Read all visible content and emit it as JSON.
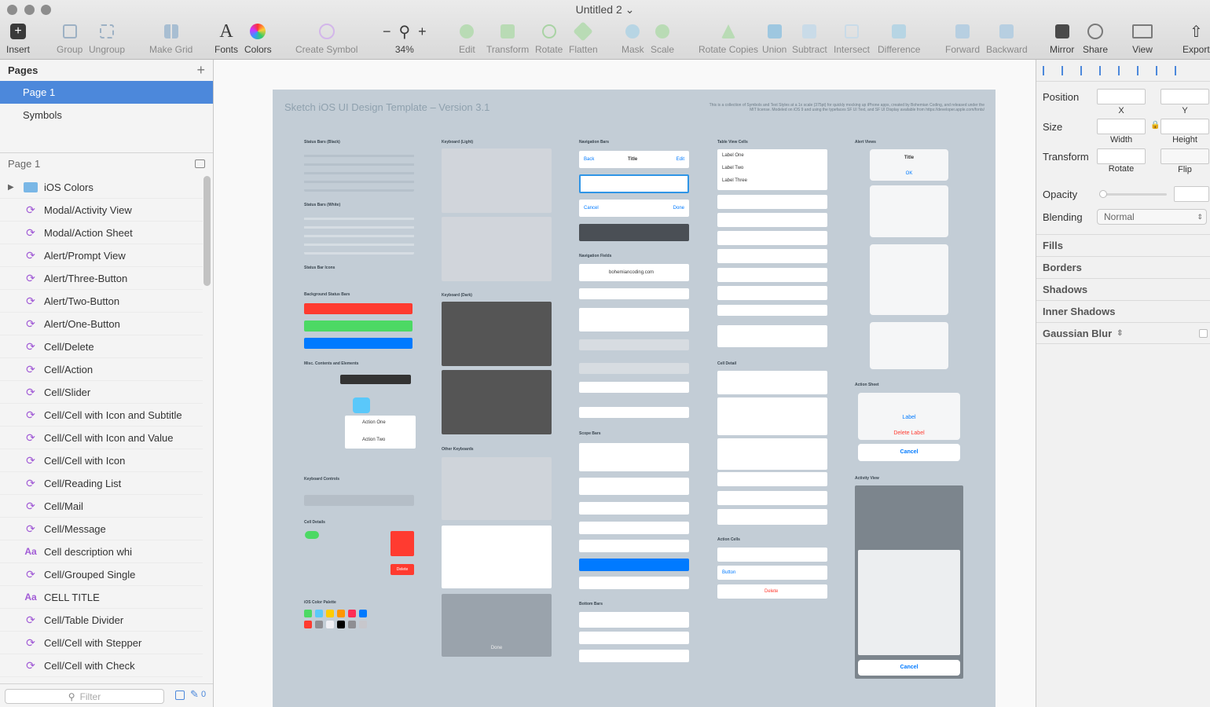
{
  "window": {
    "title": "Untitled 2 ⌄"
  },
  "toolbar": {
    "insert": "Insert",
    "group": "Group",
    "ungroup": "Ungroup",
    "make_grid": "Make Grid",
    "fonts": "Fonts",
    "colors": "Colors",
    "create_symbol": "Create Symbol",
    "zoom": "34%",
    "edit": "Edit",
    "transform": "Transform",
    "rotate": "Rotate",
    "flatten": "Flatten",
    "mask": "Mask",
    "scale": "Scale",
    "rotate_copies": "Rotate Copies",
    "union": "Union",
    "subtract": "Subtract",
    "intersect": "Intersect",
    "difference": "Difference",
    "forward": "Forward",
    "backward": "Backward",
    "mirror": "Mirror",
    "share": "Share",
    "view": "View",
    "export": "Export"
  },
  "pages": {
    "title": "Pages",
    "items": [
      "Page 1",
      "Symbols"
    ],
    "selected": "Page 1"
  },
  "layers": {
    "title": "Page 1",
    "items": [
      {
        "label": "iOS Colors",
        "type": "folder"
      },
      {
        "label": "Modal/Activity View",
        "type": "symbol"
      },
      {
        "label": "Modal/Action Sheet",
        "type": "symbol"
      },
      {
        "label": "Alert/Prompt View",
        "type": "symbol"
      },
      {
        "label": "Alert/Three-Button",
        "type": "symbol"
      },
      {
        "label": "Alert/Two-Button",
        "type": "symbol"
      },
      {
        "label": "Alert/One-Button",
        "type": "symbol"
      },
      {
        "label": "Cell/Delete",
        "type": "symbol"
      },
      {
        "label": "Cell/Action",
        "type": "symbol"
      },
      {
        "label": "Cell/Slider",
        "type": "symbol"
      },
      {
        "label": "Cell/Cell with Icon and Subtitle",
        "type": "symbol"
      },
      {
        "label": "Cell/Cell with Icon and Value",
        "type": "symbol"
      },
      {
        "label": "Cell/Cell with Icon",
        "type": "symbol"
      },
      {
        "label": "Cell/Reading List",
        "type": "symbol"
      },
      {
        "label": "Cell/Mail",
        "type": "symbol"
      },
      {
        "label": "Cell/Message",
        "type": "symbol"
      },
      {
        "label": "Cell description whi",
        "type": "text"
      },
      {
        "label": "Cell/Grouped Single",
        "type": "symbol"
      },
      {
        "label": "CELL TITLE",
        "type": "text"
      },
      {
        "label": "Cell/Table Divider",
        "type": "symbol"
      },
      {
        "label": "Cell/Cell with Stepper",
        "type": "symbol"
      },
      {
        "label": "Cell/Cell with Check",
        "type": "symbol"
      }
    ],
    "filter_placeholder": "Filter",
    "count": "0"
  },
  "artboard": {
    "title": "Sketch iOS UI Design Template – Version 3.1",
    "note": "This is a collection of Symbols and Text Styles at a 1x scale (375pt) for quickly mocking up iPhone apps, created by Bohemian Coding, and released under the MIT license. Modeled on iOS 9 and using the typefaces SF UI Text, and SF UI Display available from https://developer.apple.com/fonts/",
    "sections": {
      "status_bars_black": "Status Bars (Black)",
      "status_bars_white": "Status Bars (White)",
      "status_bar_icons": "Status Bar Icons",
      "background_status_bars": "Background Status Bars",
      "misc": "Misc. Contents and Elements",
      "keyboard_controls": "Keyboard Controls",
      "cell_details": "Cell Details",
      "color_palette": "iOS Color Palette",
      "keyboard_light": "Keyboard (Light)",
      "keyboard_dark": "Keyboard (Dark)",
      "other_keyboards": "Other Keyboards",
      "navigation_bars": "Navigation Bars",
      "navigation_fields": "Navigation Fields",
      "scope_bars": "Scope Bars",
      "bottom_bars": "Bottom Bars",
      "table_view_cells": "Table View Cells",
      "cell_detail": "Cell Detail",
      "action_cells": "Action Cells",
      "alert_views": "Alert Views",
      "action_sheet": "Action Sheet",
      "activity_view": "Activity View"
    },
    "samples": {
      "nav_title": "Title",
      "nav_back": "Back",
      "nav_edit": "Edit",
      "nav_cancel": "Cancel",
      "nav_done": "Done",
      "search_field": "bohemiancoding.com",
      "cell_labels": [
        "Label One",
        "Label Two",
        "Label Three"
      ],
      "alert_title": "Title",
      "alert_ok": "OK",
      "sheet_cancel": "Cancel",
      "sheet_label": "Label",
      "sheet_delete": "Delete Label",
      "activity_cancel": "Cancel",
      "done": "Done",
      "action_one": "Action One",
      "action_two": "Action Two",
      "delete": "Delete",
      "button": "Button"
    },
    "palette": [
      "#4cd964",
      "#5ac8fa",
      "#ffcc00",
      "#ff9500",
      "#ff2d55",
      "#007aff",
      "#ff3b30",
      "#8e8e93",
      "#efeff4",
      "#000000",
      "#8e8e93",
      "#c7c7cc"
    ]
  },
  "inspector": {
    "position": "Position",
    "x": "X",
    "y": "Y",
    "size": "Size",
    "width": "Width",
    "height": "Height",
    "transform": "Transform",
    "rotate": "Rotate",
    "flip": "Flip",
    "opacity": "Opacity",
    "blending": "Blending",
    "blending_value": "Normal",
    "fills": "Fills",
    "borders": "Borders",
    "shadows": "Shadows",
    "inner_shadows": "Inner Shadows",
    "gaussian_blur": "Gaussian Blur"
  }
}
